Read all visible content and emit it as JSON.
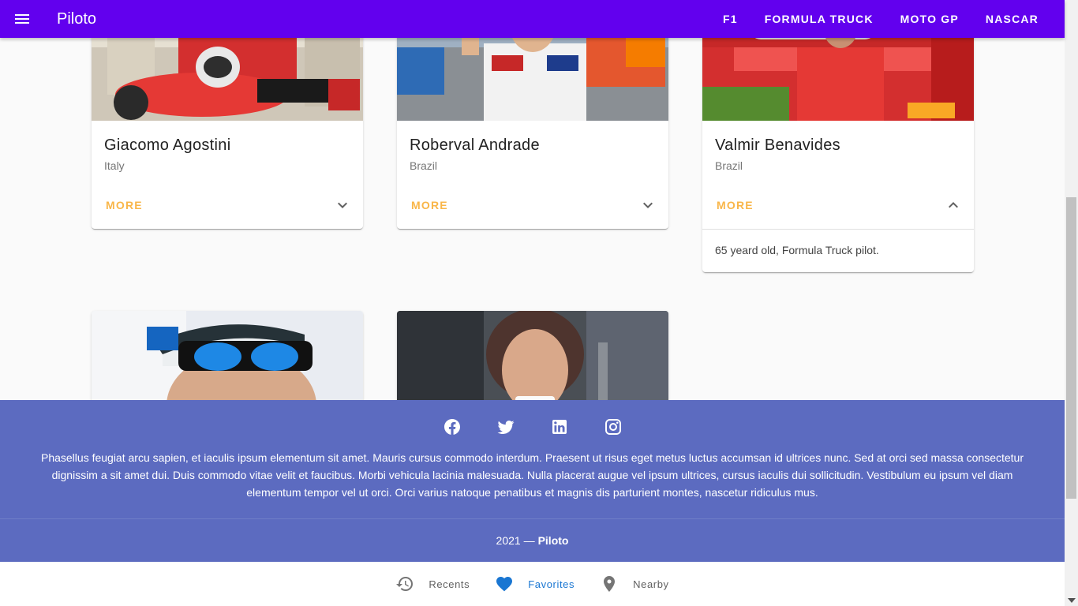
{
  "app": {
    "title": "Piloto",
    "nav": [
      "F1",
      "FORMULA TRUCK",
      "MOTO GP",
      "NASCAR"
    ]
  },
  "cards": [
    {
      "name": "Giacomo Agostini",
      "country": "Italy",
      "action": "MORE",
      "expanded": false
    },
    {
      "name": "Roberval Andrade",
      "country": "Brazil",
      "action": "MORE",
      "expanded": false
    },
    {
      "name": "Valmir Benavides",
      "country": "Brazil",
      "action": "MORE",
      "expanded": true,
      "details": "65 yeard old, Formula Truck pilot."
    }
  ],
  "footer": {
    "social_icons": [
      "facebook-icon",
      "twitter-icon",
      "linkedin-icon",
      "instagram-icon"
    ],
    "text": "Phasellus feugiat arcu sapien, et iaculis ipsum elementum sit amet. Mauris cursus commodo interdum. Praesent ut risus eget metus luctus accumsan id ultrices nunc. Sed at orci sed massa consectetur dignissim a sit amet dui. Duis commodo vitae velit et faucibus. Morbi vehicula lacinia malesuada. Nulla placerat augue vel ipsum ultrices, cursus iaculis dui sollicitudin. Vestibulum eu ipsum vel diam elementum tempor vel ut orci. Orci varius natoque penatibus et magnis dis parturient montes, nascetur ridiculus mus.",
    "copyright_year": "2021 —",
    "copyright_name": "Piloto"
  },
  "bottom_nav": [
    {
      "label": "Recents",
      "icon": "history-icon",
      "active": false
    },
    {
      "label": "Favorites",
      "icon": "heart-icon",
      "active": true
    },
    {
      "label": "Nearby",
      "icon": "location-pin-icon",
      "active": false
    }
  ],
  "colors": {
    "appbar": "#6200ee",
    "footer": "#5c6bc0",
    "more_button": "#f9b649",
    "active_nav": "#1976d2"
  }
}
